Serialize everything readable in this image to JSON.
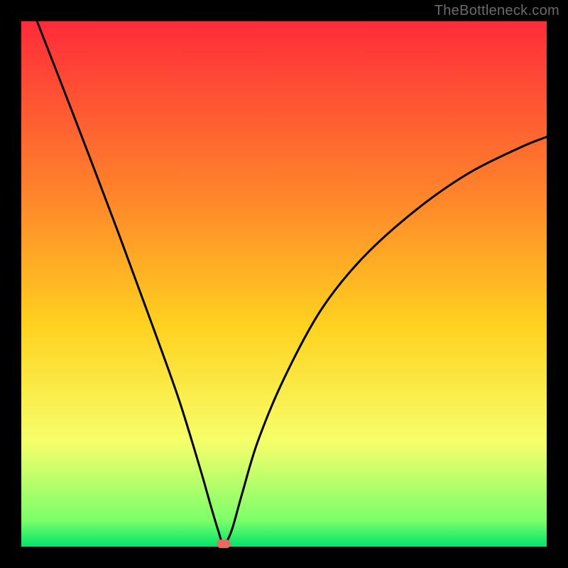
{
  "watermark": "TheBottleneck.com",
  "colors": {
    "background": "#000000",
    "gradient_top": "#ff2b3a",
    "gradient_upper_mid": "#ff8a2a",
    "gradient_mid": "#ffd21f",
    "gradient_low": "#f6ff6a",
    "gradient_lower": "#7cff6a",
    "gradient_bottom": "#00e36a",
    "curve": "#000000",
    "marker": "#e46a63"
  },
  "chart_data": {
    "type": "line",
    "title": "",
    "xlabel": "",
    "ylabel": "",
    "xlim": [
      0,
      100
    ],
    "ylim": [
      0,
      100
    ],
    "grid": false,
    "annotations": [
      "TheBottleneck.com"
    ],
    "series": [
      {
        "name": "bottleneck-curve",
        "x": [
          3,
          10,
          18,
          25,
          30,
          34,
          36,
          37.5,
          38.5,
          40,
          42,
          45,
          50,
          57,
          65,
          75,
          85,
          95,
          100
        ],
        "y": [
          100,
          82,
          61,
          42,
          28,
          15,
          8,
          3,
          0.5,
          3,
          10,
          20,
          32,
          45,
          55,
          64,
          71,
          76,
          78
        ]
      }
    ],
    "optimal_point": {
      "x": 38.5,
      "y": 0.5
    }
  }
}
